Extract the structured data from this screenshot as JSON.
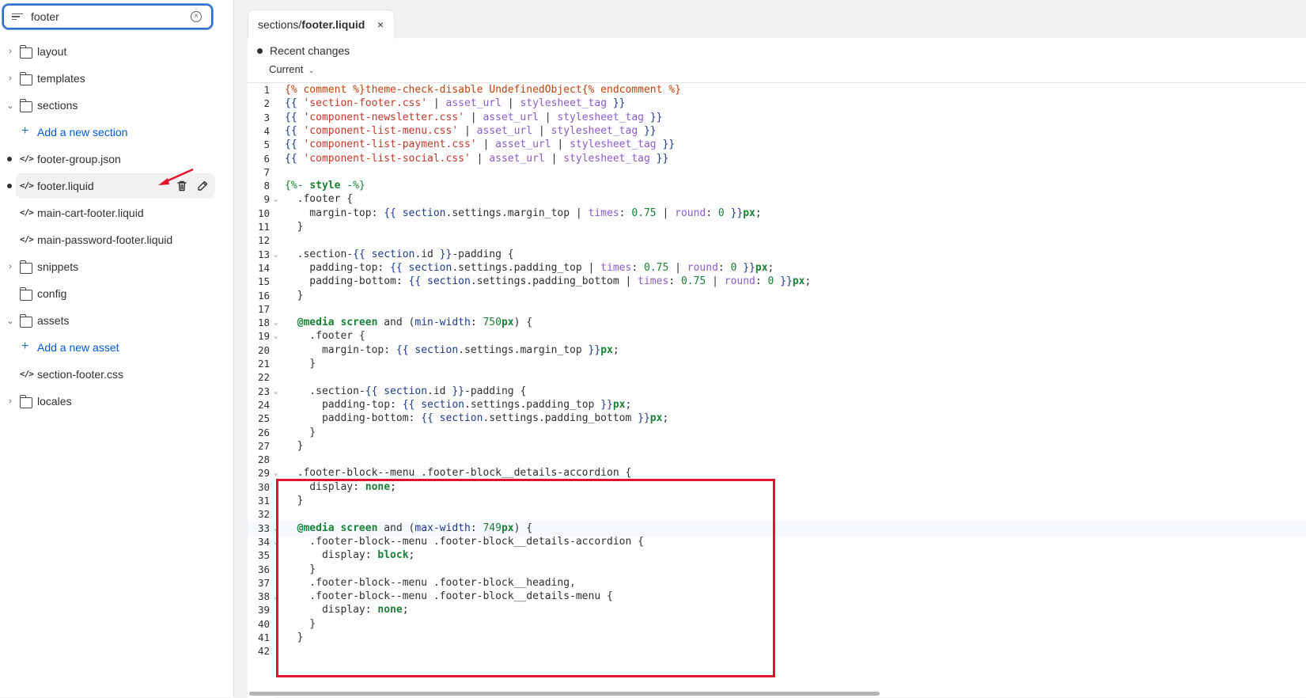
{
  "sidebar": {
    "search": {
      "value": "footer",
      "placeholder": ""
    },
    "items": [
      {
        "type": "folder",
        "label": "layout",
        "chevron": "›",
        "top": 0
      },
      {
        "type": "folder",
        "label": "templates",
        "chevron": "›"
      },
      {
        "type": "folder",
        "label": "sections",
        "chevron": "⌄"
      },
      {
        "type": "add",
        "label": "Add a new section"
      },
      {
        "type": "file",
        "label": "footer-group.json",
        "dot": true
      },
      {
        "type": "file",
        "label": "footer.liquid",
        "dot": true,
        "selected": true
      },
      {
        "type": "file",
        "label": "main-cart-footer.liquid"
      },
      {
        "type": "file",
        "label": "main-password-footer.liquid"
      },
      {
        "type": "folder",
        "label": "snippets",
        "chevron": "›"
      },
      {
        "type": "folder",
        "label": "config"
      },
      {
        "type": "folder",
        "label": "assets",
        "chevron": "⌄"
      },
      {
        "type": "add",
        "label": "Add a new asset"
      },
      {
        "type": "file",
        "label": "section-footer.css"
      },
      {
        "type": "folder",
        "label": "locales",
        "chevron": "›"
      }
    ]
  },
  "tab": {
    "path": "sections/",
    "file": "footer.liquid",
    "close": "×"
  },
  "changes": {
    "label": "Recent changes",
    "current": "Current"
  },
  "code": [
    "1",
    "2",
    "3",
    "4",
    "5",
    "6",
    "7",
    "8",
    "9",
    "10",
    "11",
    "12",
    "13",
    "14",
    "15",
    "16",
    "17",
    "18",
    "19",
    "20",
    "21",
    "22",
    "23",
    "24",
    "25",
    "26",
    "27",
    "28",
    "29",
    "30",
    "31",
    "32",
    "33",
    "34",
    "35",
    "36",
    "37",
    "38",
    "39",
    "40",
    "41",
    "42"
  ],
  "colors": {
    "accent": "#2c6ecb",
    "highlight": "#e0152b"
  }
}
